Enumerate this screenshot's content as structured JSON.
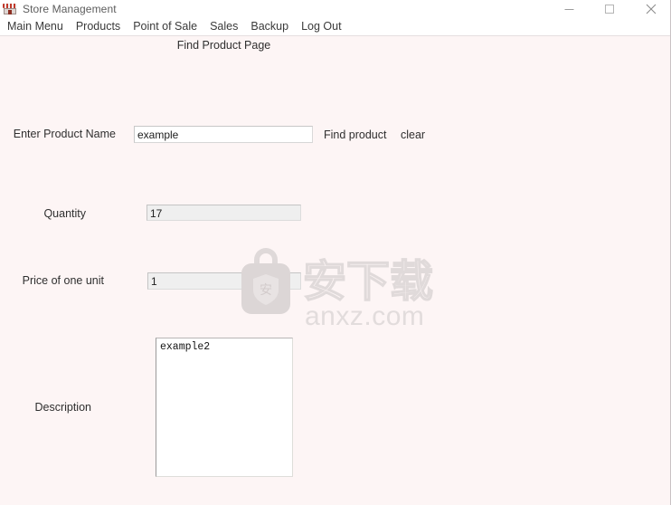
{
  "window": {
    "title": "Store Management",
    "icon": "store-icon",
    "controls": {
      "minimize": "minimize-icon",
      "maximize": "maximize-icon",
      "close": "close-icon"
    }
  },
  "menu": {
    "items": [
      {
        "label": "Main Menu"
      },
      {
        "label": "Products"
      },
      {
        "label": "Point of Sale"
      },
      {
        "label": "Sales"
      },
      {
        "label": "Backup"
      },
      {
        "label": "Log Out"
      }
    ]
  },
  "page": {
    "title": "Find Product Page"
  },
  "form": {
    "product_name": {
      "label": "Enter Product Name",
      "value": "example",
      "placeholder": ""
    },
    "quantity": {
      "label": "Quantity",
      "value": "17",
      "placeholder": ""
    },
    "price": {
      "label": "Price of one unit",
      "value": "1",
      "placeholder": ""
    },
    "description": {
      "label": "Description",
      "value": "example2",
      "placeholder": ""
    }
  },
  "actions": {
    "find_product": "Find product",
    "clear": "clear"
  },
  "watermark": {
    "text_cn": "安下载",
    "text_url": "anxz.com",
    "shield_char": "安"
  },
  "colors": {
    "window_background": "#fdf5f5",
    "titlebar_background": "#ffffff",
    "text": "#2f2f2f",
    "readonly_field": "#efefef",
    "field_border": "#c4c4c4",
    "watermark": "#e3dede"
  }
}
